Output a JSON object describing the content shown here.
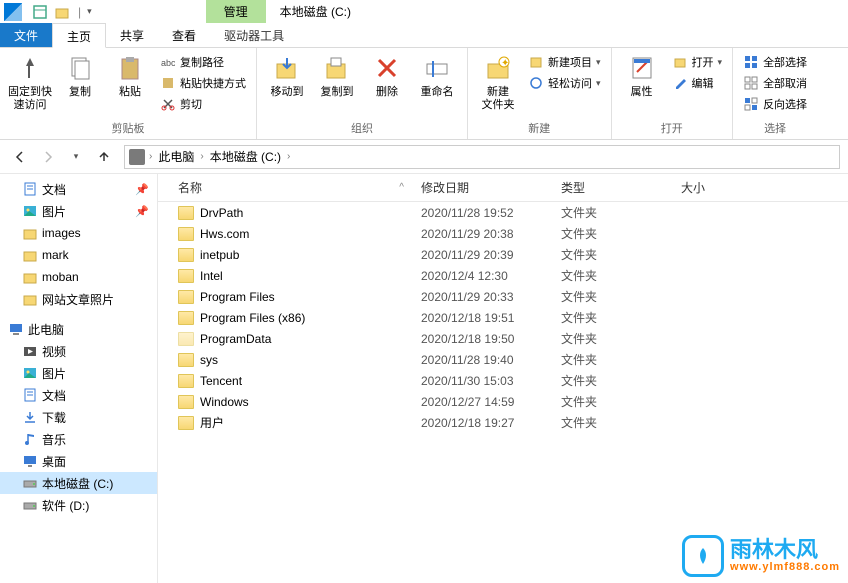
{
  "titlebar": {
    "contextual_tab": "管理",
    "window_title": "本地磁盘 (C:)"
  },
  "tabs": {
    "file": "文件",
    "home": "主页",
    "share": "共享",
    "view": "查看",
    "drive_tools": "驱动器工具"
  },
  "ribbon": {
    "pin": "固定到快\n速访问",
    "copy": "复制",
    "paste": "粘贴",
    "copy_path": "复制路径",
    "paste_shortcut": "粘贴快捷方式",
    "cut": "剪切",
    "group_clipboard": "剪贴板",
    "move_to": "移动到",
    "copy_to": "复制到",
    "delete": "删除",
    "rename": "重命名",
    "group_organize": "组织",
    "new_folder": "新建\n文件夹",
    "new_item": "新建项目",
    "easy_access": "轻松访问",
    "group_new": "新建",
    "properties": "属性",
    "open_btn": "打开",
    "edit": "编辑",
    "group_open": "打开",
    "select_all": "全部选择",
    "select_none": "全部取消",
    "invert_selection": "反向选择",
    "group_select": "选择"
  },
  "breadcrumb": {
    "this_pc": "此电脑",
    "drive": "本地磁盘 (C:)"
  },
  "columns": {
    "name": "名称",
    "date": "修改日期",
    "type": "类型",
    "size": "大小"
  },
  "sidebar": {
    "items": [
      {
        "label": "文档",
        "icon": "doc",
        "pin": true
      },
      {
        "label": "图片",
        "icon": "pic",
        "pin": true
      },
      {
        "label": "images",
        "icon": "folder"
      },
      {
        "label": "mark",
        "icon": "folder"
      },
      {
        "label": "moban",
        "icon": "folder"
      },
      {
        "label": "网站文章照片",
        "icon": "folder"
      }
    ],
    "this_pc": "此电脑",
    "pc_items": [
      {
        "label": "视频",
        "icon": "video"
      },
      {
        "label": "图片",
        "icon": "pic"
      },
      {
        "label": "文档",
        "icon": "doc"
      },
      {
        "label": "下载",
        "icon": "download"
      },
      {
        "label": "音乐",
        "icon": "music"
      },
      {
        "label": "桌面",
        "icon": "desktop"
      },
      {
        "label": "本地磁盘 (C:)",
        "icon": "drive",
        "selected": true
      },
      {
        "label": "软件 (D:)",
        "icon": "drive"
      }
    ]
  },
  "files": [
    {
      "name": "DrvPath",
      "date": "2020/11/28 19:52",
      "type": "文件夹"
    },
    {
      "name": "Hws.com",
      "date": "2020/11/29 20:38",
      "type": "文件夹"
    },
    {
      "name": "inetpub",
      "date": "2020/11/29 20:39",
      "type": "文件夹"
    },
    {
      "name": "Intel",
      "date": "2020/12/4 12:30",
      "type": "文件夹"
    },
    {
      "name": "Program Files",
      "date": "2020/11/29 20:33",
      "type": "文件夹"
    },
    {
      "name": "Program Files (x86)",
      "date": "2020/12/18 19:51",
      "type": "文件夹"
    },
    {
      "name": "ProgramData",
      "date": "2020/12/18 19:50",
      "type": "文件夹",
      "faded": true
    },
    {
      "name": "sys",
      "date": "2020/11/28 19:40",
      "type": "文件夹"
    },
    {
      "name": "Tencent",
      "date": "2020/11/30 15:03",
      "type": "文件夹"
    },
    {
      "name": "Windows",
      "date": "2020/12/27 14:59",
      "type": "文件夹"
    },
    {
      "name": "用户",
      "date": "2020/12/18 19:27",
      "type": "文件夹"
    }
  ],
  "watermark": {
    "brand": "雨林木风",
    "url": "www.ylmf888.com"
  }
}
